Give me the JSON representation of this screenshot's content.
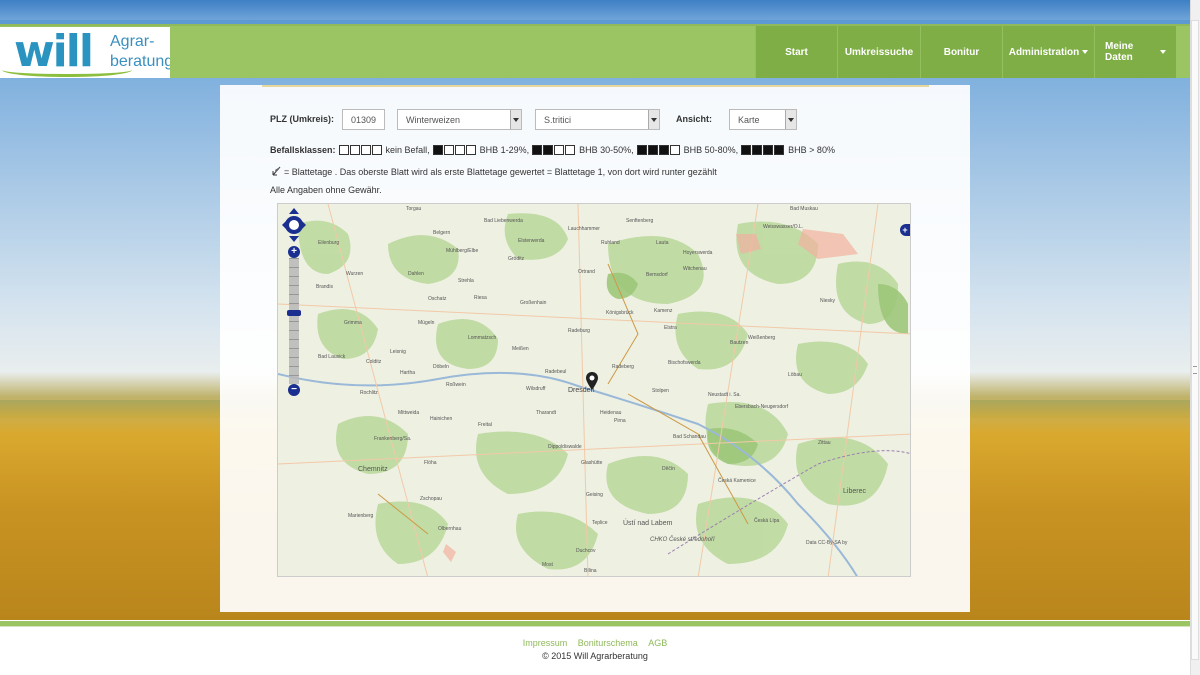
{
  "brand": {
    "logo_main": "will",
    "logo_line1": "Agrar-",
    "logo_line2": "beratung"
  },
  "nav": {
    "items": [
      {
        "label": "Start",
        "dropdown": false
      },
      {
        "label": "Umkreissuche",
        "dropdown": false
      },
      {
        "label": "Bonitur",
        "dropdown": false
      },
      {
        "label": "Administration",
        "dropdown": true
      },
      {
        "label": "Meine Daten",
        "dropdown": true
      }
    ]
  },
  "filters": {
    "plz_label": "PLZ (Umkreis):",
    "plz_value": "01309",
    "crop_value": "Winterweizen",
    "disease_value": "S.tritici",
    "view_label": "Ansicht:",
    "view_value": "Karte"
  },
  "legend": {
    "title": "Befallsklassen:",
    "class_0": "kein Befall,",
    "class_1": "BHB 1-29%,",
    "class_2": "BHB 30-50%,",
    "class_3": "BHB 50-80%,",
    "class_4": "BHB > 80%"
  },
  "notes": {
    "blattetage": "= Blattetage . Das oberste Blatt wird als erste Blattetage gewertet = Blattetage 1, von dort wird runter gezählt",
    "disclaimer": "Alle Angaben ohne Gewähr."
  },
  "map": {
    "center_label": "Dresden",
    "attribution": "Data CC-By-SA by",
    "towns": [
      "Torgau",
      "Bad Liebenwerda",
      "Senftenberg",
      "Bad Muskau",
      "Belgern",
      "Lauchhammer",
      "Weisswasser/O.L.",
      "Eilenburg",
      "Mühlberg/Elbe",
      "Elsterwerda",
      "Ruhland",
      "Lauta",
      "Hoyerswerda",
      "Gröditz",
      "Wurzen",
      "Dahlen",
      "Strehla",
      "Ortrand",
      "Bernsdorf",
      "Witchenau",
      "Brandis",
      "Oschatz",
      "Riesa",
      "Großenhain",
      "Königsbrück",
      "Kamenz",
      "Niesky",
      "Grimma",
      "Mügeln",
      "Lommatzsch",
      "Elstra",
      "Weißenberg",
      "Bad Lausick",
      "Leisnig",
      "Meißen",
      "Radeburg",
      "Bautzen",
      "Colditz",
      "Hartha",
      "Döbeln",
      "Radebeul",
      "Radeberg",
      "Bischofswerda",
      "Löbau",
      "Rochlitz",
      "Roßwein",
      "Wilsdruff",
      "Stolpen",
      "Neustadt i. Sa.",
      "Mittweida",
      "Hainichen",
      "Freital",
      "Tharandt",
      "Heidenau",
      "Pirna",
      "Ebersbach-Neugersdorf",
      "Zittau",
      "Frankenberg/Sa.",
      "Flöha",
      "Dippoldiswalde",
      "Bad Schandau",
      "Chemnitz",
      "Glashütte",
      "Děčín",
      "Česká Kamenice",
      "Liberec",
      "Zschopau",
      "Geising",
      "Ústí nad Labem",
      "Marienberg",
      "Teplice",
      "Česká Lípa",
      "Olbernhau",
      "Duchcov",
      "Most",
      "Bílina",
      "CHKO České středohoří"
    ]
  },
  "footer": {
    "link_impressum": "Impressum",
    "link_boniturschema": "Boniturschema",
    "link_agb": "AGB",
    "copyright": "© 2015 Will Agrarberatung"
  }
}
